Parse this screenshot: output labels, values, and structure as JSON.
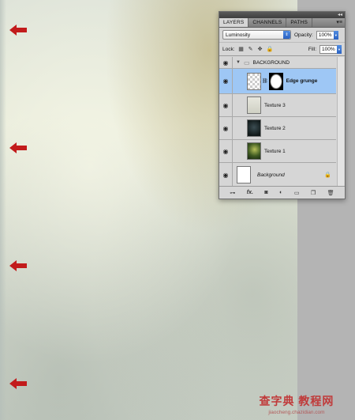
{
  "panel": {
    "tabs": [
      "LAYERS",
      "CHANNELS",
      "PATHS"
    ],
    "blend_mode": "Luminosity",
    "opacity_label": "Opacity:",
    "opacity_value": "100%",
    "lock_label": "Lock:",
    "fill_label": "Fill:",
    "fill_value": "100%"
  },
  "layers": [
    {
      "name": "BACKGROUND",
      "type": "group"
    },
    {
      "name": "Edge grunge",
      "type": "masked",
      "selected": true
    },
    {
      "name": "Texture 3",
      "type": "layer"
    },
    {
      "name": "Texture 2",
      "type": "layer"
    },
    {
      "name": "Texture 1",
      "type": "layer"
    },
    {
      "name": "Background",
      "type": "background"
    }
  ],
  "icons": {
    "eye": "eye-icon",
    "folder": "folder-icon",
    "lock": "lock-icon",
    "link": "link-icon",
    "fx": "fx-icon",
    "mask": "mask-icon",
    "adjustment": "adjustment-icon",
    "new_group": "new-group-icon",
    "new_layer": "new-layer-icon",
    "trash": "trash-icon"
  },
  "bottom_bar": {
    "fx_label": "fx."
  },
  "accent_color": "#c21b1b",
  "selected_row_color": "#9ec7f5",
  "watermark": {
    "main": "查字典 教程网",
    "sub": "jiaocheng.chazidian.com"
  }
}
